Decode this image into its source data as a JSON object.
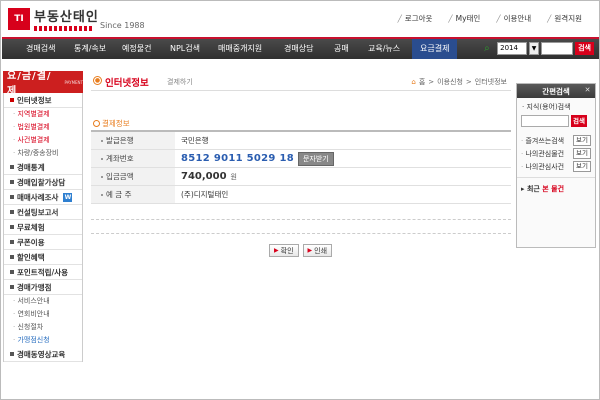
{
  "header": {
    "logo_mark": "TI",
    "logo_text": "부동산태인",
    "logo_since": "Since 1988",
    "links": [
      {
        "label": "로그아웃",
        "icon": "logout-icon"
      },
      {
        "label": "My태인",
        "icon": "user-icon"
      },
      {
        "label": "이용안내",
        "icon": "info-icon"
      },
      {
        "label": "원격지원",
        "icon": "remote-icon"
      }
    ]
  },
  "nav": {
    "items": [
      "경매검색",
      "통계/속보",
      "예정물건",
      "NPL검색",
      "매매중개지원",
      "경매상담",
      "공매",
      "교육/뉴스",
      "요금결제"
    ],
    "active_index": 8,
    "search": {
      "year": "2014",
      "go_label": "검색"
    }
  },
  "leftnav": {
    "title": "요/금/결/제",
    "title_small": "PAYMENT",
    "sections": [
      {
        "label": "인터넷정보",
        "subs": [
          {
            "label": "지역별결제",
            "style": "red"
          },
          {
            "label": "법원별결제",
            "style": "red"
          },
          {
            "label": "사건별결제",
            "style": "red"
          },
          {
            "label": "차량/중송장비",
            "style": ""
          }
        ]
      },
      {
        "label": "경매통계",
        "subs": []
      },
      {
        "label": "경매입찰가상담",
        "subs": []
      },
      {
        "label": "매매사례조사",
        "badge": "W",
        "subs": []
      },
      {
        "label": "컨설팅보고서",
        "subs": []
      },
      {
        "label": "무료체험",
        "subs": []
      },
      {
        "label": "쿠폰이용",
        "subs": []
      },
      {
        "label": "할인혜택",
        "subs": []
      },
      {
        "label": "포인트적립/사용",
        "subs": []
      },
      {
        "label": "경매가맹점",
        "subs": [
          {
            "label": "서비스안내",
            "style": ""
          },
          {
            "label": "연회비안내",
            "style": ""
          },
          {
            "label": "신청절차",
            "style": ""
          },
          {
            "label": "가맹점신청",
            "style": "blue"
          }
        ]
      },
      {
        "label": "경매동영상교육",
        "subs": []
      }
    ]
  },
  "content": {
    "title": "인터넷정보",
    "subtitle": "결제하기",
    "breadcrumb": [
      "홈",
      "이용신청",
      "인터넷정보"
    ],
    "section_title": "결제정보",
    "rows": [
      {
        "label": "발급은행",
        "value": "국민은행"
      },
      {
        "label": "계좌번호",
        "value": "8512 9011 5029 18",
        "button": "문자받기"
      },
      {
        "label": "입금금액",
        "value": "740,000",
        "unit": "원"
      },
      {
        "label": "예 금 주",
        "value": "(주)디지털태인"
      }
    ],
    "buttons": {
      "confirm": "확인",
      "print": "인쇄"
    }
  },
  "rightpanel": {
    "title": "간편검색",
    "search_label": "지식(용어)검색",
    "go_label": "검색",
    "rows": [
      {
        "label": "즐겨쓰는검색",
        "button": "보기"
      },
      {
        "label": "나의관심물건",
        "button": "보기"
      },
      {
        "label": "나의관심사건",
        "button": "보기"
      }
    ],
    "recent_prefix": "최근",
    "recent_highlight": "본 물건"
  }
}
